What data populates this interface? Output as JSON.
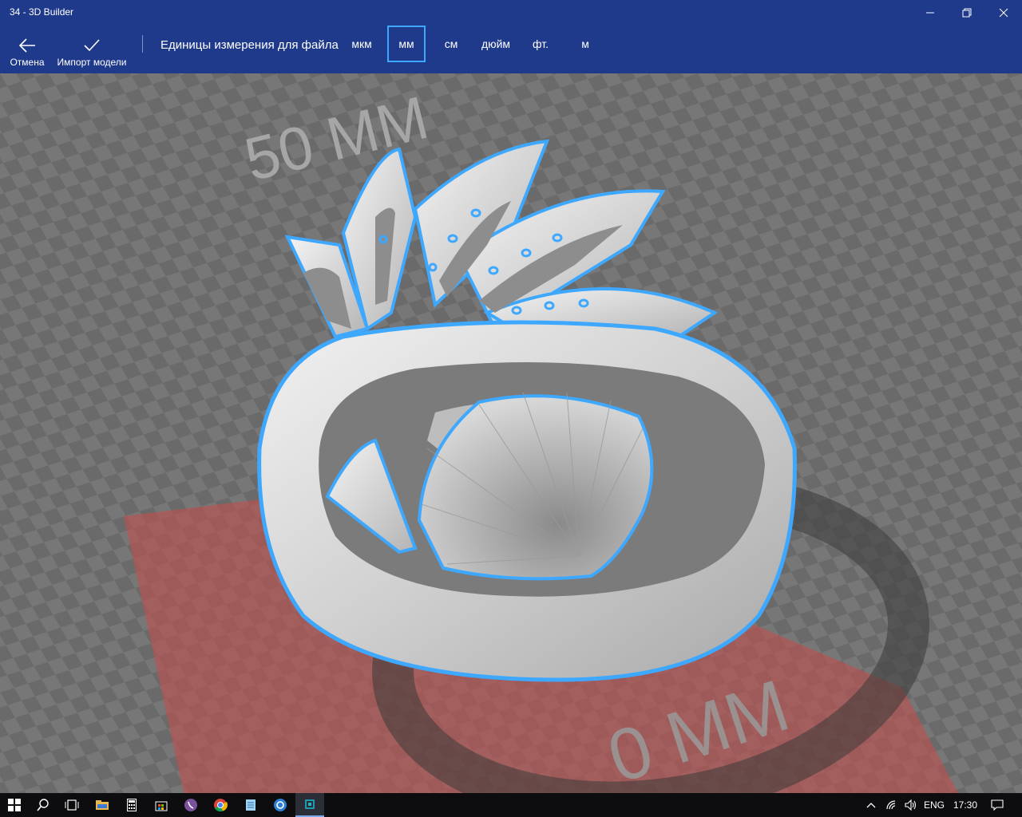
{
  "window": {
    "title": "34 - 3D Builder"
  },
  "toolbar": {
    "back_label": "Отмена",
    "import_label": "Импорт модели",
    "units_label": "Единицы измерения для файла",
    "units": [
      "мкм",
      "мм",
      "см",
      "дюйм",
      "фт.",
      "м"
    ],
    "selected_unit": "мм"
  },
  "viewport": {
    "scale_top_label": "50 MM",
    "scale_bottom_label": "0 MM",
    "selection_color": "#3ea8ff",
    "plate_color": "#c0504d"
  },
  "taskbar": {
    "icons": [
      "windows-start-icon",
      "search-icon",
      "task-view-icon",
      "file-explorer-icon",
      "calculator-icon",
      "store-icon",
      "viber-icon",
      "chrome-icon",
      "notepad-icon",
      "browser-icon",
      "3d-builder-icon"
    ],
    "language": "ENG",
    "time": "17:30"
  }
}
